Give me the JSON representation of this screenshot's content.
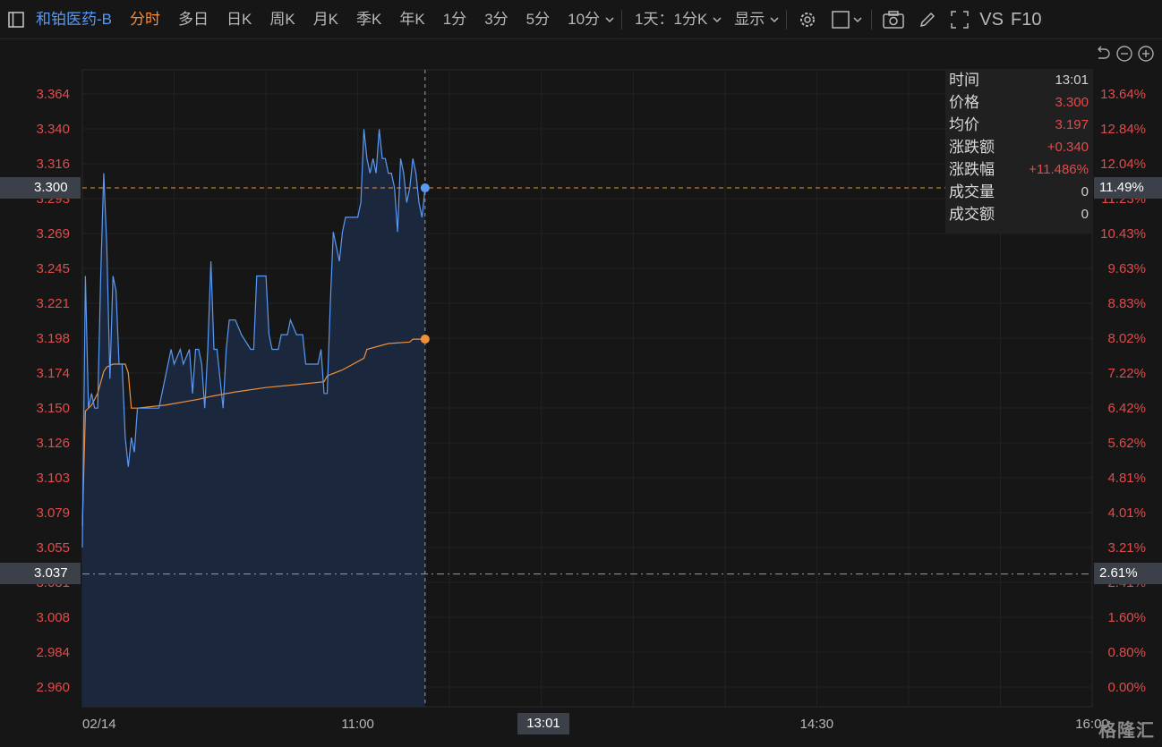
{
  "toolbar": {
    "stock_name": "和铂医药-B",
    "tabs": [
      "分时",
      "多日",
      "日K",
      "周K",
      "月K",
      "季K",
      "年K",
      "1分",
      "3分",
      "5分",
      "10分"
    ],
    "active_tab": "分时",
    "period_select": "1天：1分K",
    "display_label": "显示",
    "vs_label": "VS",
    "f10_label": "F10"
  },
  "info_panel": {
    "rows": [
      {
        "label": "时间",
        "value": "13:01"
      },
      {
        "label": "价格",
        "value": "3.300"
      },
      {
        "label": "均价",
        "value": "3.197"
      },
      {
        "label": "涨跌额",
        "value": "+0.340"
      },
      {
        "label": "涨跌幅",
        "value": "+11.486%"
      },
      {
        "label": "成交量",
        "value": "0"
      },
      {
        "label": "成交额",
        "value": "0"
      }
    ]
  },
  "tags": {
    "left_price": "3.300",
    "right_price_pct": "11.49%",
    "left_prev_close": "3.037",
    "right_prev_close_pct": "2.61%",
    "cursor_time": "13:01"
  },
  "watermark": "格隆汇",
  "colors": {
    "price_line": "#5a9af3",
    "avg_line": "#f0903a",
    "up": "#e24b4b",
    "accent": "#ff8a2c"
  },
  "chart_data": {
    "type": "line",
    "y_left_ticks": [
      "3.364",
      "3.340",
      "3.316",
      "3.293",
      "3.269",
      "3.245",
      "3.221",
      "3.198",
      "3.174",
      "3.150",
      "3.126",
      "3.103",
      "3.079",
      "3.055",
      "3.031",
      "3.008",
      "2.984",
      "2.960"
    ],
    "y_right_ticks": [
      "13.64%",
      "12.84%",
      "12.04%",
      "11.23%",
      "10.43%",
      "9.63%",
      "8.83%",
      "8.02%",
      "7.22%",
      "6.42%",
      "5.62%",
      "4.81%",
      "4.01%",
      "3.21%",
      "2.41%",
      "1.60%",
      "0.80%",
      "0.00%"
    ],
    "ylim": [
      2.96,
      3.364
    ],
    "x_ticks": [
      "02/14",
      "11:00",
      "13:00",
      "14:30",
      "16:00"
    ],
    "prev_close": 3.037,
    "last_time": "13:01",
    "series": [
      {
        "values": [
          [
            0,
            3.055
          ],
          [
            1,
            3.24
          ],
          [
            2,
            3.15
          ],
          [
            3,
            3.16
          ],
          [
            4,
            3.15
          ],
          [
            5,
            3.15
          ],
          [
            6,
            3.24
          ],
          [
            7,
            3.31
          ],
          [
            8,
            3.26
          ],
          [
            9,
            3.17
          ],
          [
            10,
            3.24
          ],
          [
            11,
            3.23
          ],
          [
            12,
            3.18
          ],
          [
            13,
            3.18
          ],
          [
            14,
            3.13
          ],
          [
            15,
            3.11
          ],
          [
            16,
            3.13
          ],
          [
            17,
            3.12
          ],
          [
            18,
            3.15
          ],
          [
            19,
            3.15
          ],
          [
            20,
            3.15
          ],
          [
            22,
            3.15
          ],
          [
            25,
            3.15
          ],
          [
            27,
            3.17
          ],
          [
            29,
            3.19
          ],
          [
            30,
            3.18
          ],
          [
            32,
            3.19
          ],
          [
            33,
            3.18
          ],
          [
            35,
            3.19
          ],
          [
            36,
            3.16
          ],
          [
            37,
            3.19
          ],
          [
            38,
            3.19
          ],
          [
            39,
            3.18
          ],
          [
            40,
            3.15
          ],
          [
            41,
            3.19
          ],
          [
            42,
            3.25
          ],
          [
            43,
            3.19
          ],
          [
            44,
            3.19
          ],
          [
            45,
            3.17
          ],
          [
            46,
            3.15
          ],
          [
            47,
            3.19
          ],
          [
            48,
            3.21
          ],
          [
            49,
            3.21
          ],
          [
            50,
            3.21
          ],
          [
            52,
            3.2
          ],
          [
            55,
            3.19
          ],
          [
            56,
            3.19
          ],
          [
            57,
            3.24
          ],
          [
            60,
            3.24
          ],
          [
            61,
            3.2
          ],
          [
            62,
            3.19
          ],
          [
            64,
            3.19
          ],
          [
            65,
            3.2
          ],
          [
            67,
            3.2
          ],
          [
            68,
            3.21
          ],
          [
            70,
            3.2
          ],
          [
            72,
            3.2
          ],
          [
            73,
            3.18
          ],
          [
            75,
            3.18
          ],
          [
            77,
            3.18
          ],
          [
            78,
            3.19
          ],
          [
            79,
            3.16
          ],
          [
            80,
            3.16
          ],
          [
            81,
            3.22
          ],
          [
            82,
            3.27
          ],
          [
            83,
            3.26
          ],
          [
            84,
            3.25
          ],
          [
            85,
            3.27
          ],
          [
            86,
            3.28
          ],
          [
            90,
            3.28
          ],
          [
            91,
            3.29
          ],
          [
            92,
            3.34
          ],
          [
            93,
            3.32
          ],
          [
            94,
            3.31
          ],
          [
            95,
            3.32
          ],
          [
            96,
            3.31
          ],
          [
            97,
            3.34
          ],
          [
            98,
            3.32
          ],
          [
            99,
            3.32
          ],
          [
            100,
            3.31
          ],
          [
            101,
            3.31
          ],
          [
            102,
            3.3
          ],
          [
            103,
            3.27
          ],
          [
            104,
            3.32
          ],
          [
            105,
            3.31
          ],
          [
            106,
            3.29
          ],
          [
            107,
            3.3
          ],
          [
            108,
            3.32
          ],
          [
            109,
            3.31
          ],
          [
            110,
            3.29
          ],
          [
            111,
            3.28
          ],
          [
            112,
            3.3
          ]
        ]
      },
      {
        "values": [
          [
            0,
            3.07
          ],
          [
            1,
            3.148
          ],
          [
            3,
            3.152
          ],
          [
            5,
            3.16
          ],
          [
            7,
            3.175
          ],
          [
            8,
            3.178
          ],
          [
            10,
            3.18
          ],
          [
            14,
            3.18
          ],
          [
            15,
            3.174
          ],
          [
            16,
            3.15
          ],
          [
            18,
            3.15
          ],
          [
            27,
            3.152
          ],
          [
            38,
            3.156
          ],
          [
            42,
            3.158
          ],
          [
            50,
            3.161
          ],
          [
            60,
            3.164
          ],
          [
            70,
            3.166
          ],
          [
            79,
            3.168
          ],
          [
            80,
            3.172
          ],
          [
            85,
            3.176
          ],
          [
            92,
            3.184
          ],
          [
            93,
            3.19
          ],
          [
            100,
            3.194
          ],
          [
            107,
            3.195
          ],
          [
            108,
            3.197
          ],
          [
            112,
            3.197
          ]
        ]
      }
    ]
  }
}
